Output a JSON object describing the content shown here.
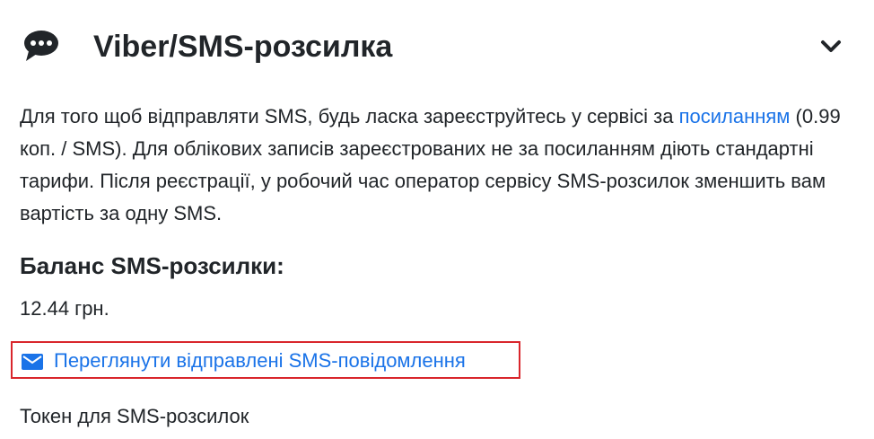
{
  "header": {
    "title": "Viber/SMS-розсилка",
    "icon": "chat-bubble-icon",
    "toggle_icon": "chevron-down-icon"
  },
  "description": {
    "part1": "Для того щоб відправляти SMS, будь ласка зареєструйтесь у сервісі за ",
    "link_text": "посиланням",
    "part2": " (0.99 коп. / SMS). Для облікових записів зареєстрованих не за посиланням діють стандартні тарифи. Після реєстрації, у робочий час оператор сервісу SMS-розсилок зменшить вам вартість за одну SMS."
  },
  "balance": {
    "heading": "Баланс SMS-розсилки:",
    "value": "12.44 грн."
  },
  "view_messages": {
    "icon": "envelope-icon",
    "label": "Переглянути відправлені SMS-повідомлення"
  },
  "token": {
    "label": "Токен для SMS-розсилок"
  },
  "colors": {
    "text": "#212529",
    "link": "#1a73e8",
    "highlight_border": "#d9262c"
  }
}
